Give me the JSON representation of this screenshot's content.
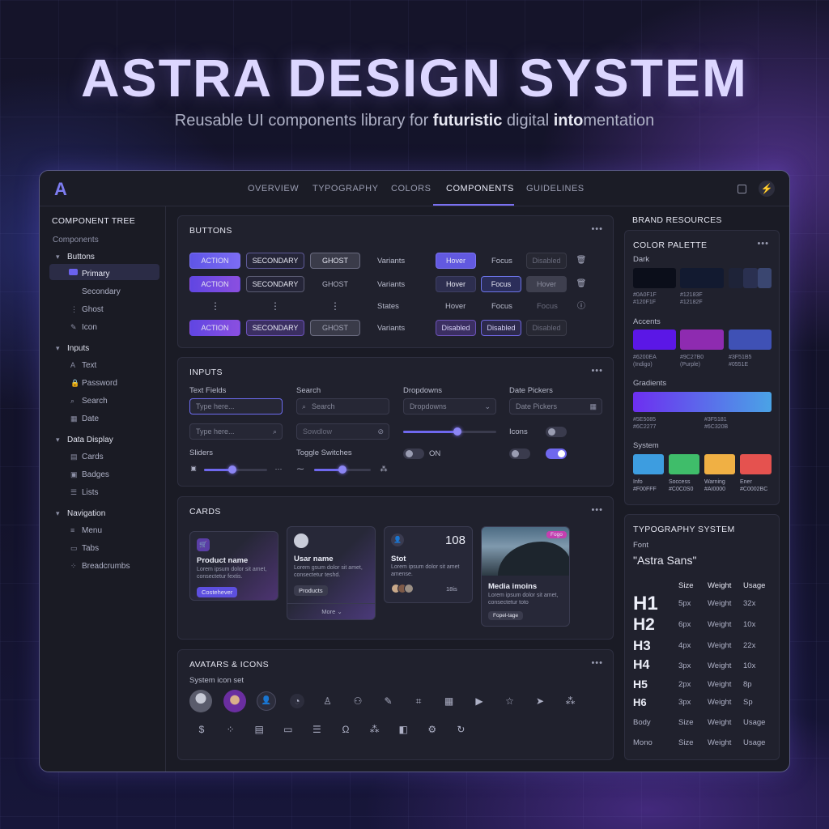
{
  "hero": {
    "title": "ASTRA DESIGN SYSTEM",
    "subtitle_pre": "Reusable UI components library for ",
    "subtitle_bold1": "futuristic",
    "subtitle_mid": " digital ",
    "subtitle_bold2": "into",
    "subtitle_post": "mentation"
  },
  "topbar": {
    "logo": "A",
    "tabs": [
      "OVERVIEW",
      "TYPOGRAPHY",
      "COLORS",
      "COMPONENTS",
      "GUIDELINES"
    ],
    "active_tab": "COMPONENTS"
  },
  "sidebar": {
    "title": "COMPONENT TREE",
    "root": "Components",
    "groups": [
      {
        "label": "Buttons",
        "items": [
          "Primary",
          "Secondary",
          "Ghost",
          "Icon"
        ]
      },
      {
        "label": "Inputs",
        "items": [
          "Text",
          "Password",
          "Search",
          "Date"
        ]
      },
      {
        "label": "Data Display",
        "items": [
          "Cards",
          "Badges",
          "Lists"
        ]
      },
      {
        "label": "Navigation",
        "items": [
          "Menu",
          "Tabs",
          "Breadcrumbs"
        ]
      }
    ]
  },
  "buttons": {
    "title": "BUTTONS",
    "action": "ACTION",
    "secondary": "SECONDARY",
    "ghost": "GHOST",
    "variants": "Variants",
    "states": "States",
    "hover": "Hover",
    "focus": "Focus",
    "disabled": "Disabled"
  },
  "inputs": {
    "title": "INPUTS",
    "text_fields": "Text Fields",
    "search": "Search",
    "dropdowns": "Dropdowns",
    "date_pickers": "Date Pickers",
    "type_here": "Type here...",
    "search_ph": "Search",
    "search_ph2": "Sowdlow",
    "dropdowns_ph": "Dropdowns",
    "date_ph": "Date Pickers",
    "sliders": "Sliders",
    "toggle_switches": "Toggle Switches",
    "icons": "Icons",
    "on": "ON",
    "slider1": 0.58,
    "slider2": 0.45,
    "slider3": 0.5,
    "slider4": 0.62
  },
  "cards": {
    "title": "CARDS",
    "product": {
      "title": "Product name",
      "desc": "Lorem ipsum dolor sit amet, consectetur fextis.",
      "chip": "Costehever"
    },
    "user": {
      "title": "Usar name",
      "desc": "Lorem gsum dolor sit amet, consectetur teshd.",
      "chip": "Products",
      "more": "More"
    },
    "stat": {
      "title": "Stot",
      "value": "108",
      "desc": "Lorem ipsum dolor sit amet amense.",
      "count": "18is"
    },
    "media": {
      "badge": "Fogo",
      "title": "Media imoins",
      "desc": "Lorem ipsum dolor sit amet, consectetur toto",
      "chip": "Fopel-tage"
    }
  },
  "avatars": {
    "title": "AVATARS & ICONS",
    "subtitle": "System icon set",
    "icons_row1": [
      "dashboard-icon",
      "user-icon",
      "users-icon",
      "edit-icon",
      "code-icon",
      "calendar-icon",
      "play-icon",
      "star-icon",
      "send-icon",
      "grid-icon"
    ],
    "icons_row2": [
      "dollar-icon",
      "apps-icon",
      "table-icon",
      "monitor-icon",
      "list-icon",
      "text-icon",
      "grid-icon",
      "sidebar-icon",
      "settings-icon",
      "refresh-icon"
    ]
  },
  "resources": {
    "title": "BRAND RESOURCES",
    "palette_title": "COLOR PALETTE",
    "dark_label": "Dark",
    "accents_label": "Accents",
    "gradients_label": "Gradients",
    "system_label": "System",
    "dark": [
      {
        "color": "#0b0e1a",
        "hex": "#0A0F1F",
        "sub": "#120F1F"
      },
      {
        "color": "#121a30",
        "hex": "#12183F",
        "sub": "#12182F"
      }
    ],
    "dark3": [
      "#1e2338",
      "#2a3050",
      "#3a4670"
    ],
    "accents": [
      {
        "color": "#5b17e6",
        "hex": "#6200EA",
        "sub": "(Indigo)"
      },
      {
        "color": "#8e2bb0",
        "hex": "#9C27B0",
        "sub": "(Purple)"
      },
      {
        "color": "#3f51b5",
        "hex": "#3F51B5",
        "sub": "#0551E"
      }
    ],
    "gradient": {
      "from": "#6d2ff0",
      "to": "#4aa3e6",
      "hex1": "#5E5085",
      "sub1": "#6C2277",
      "hex2": "#3F5181",
      "sub2": "#6C320B"
    },
    "system": [
      {
        "color": "#3d9de0",
        "name": "Info",
        "hex": "#F00FFF"
      },
      {
        "color": "#3fbd6a",
        "name": "Soccess",
        "hex": "#C0C0S0"
      },
      {
        "color": "#f0b044",
        "name": "Warning",
        "hex": "#AI0000"
      },
      {
        "color": "#e5524f",
        "name": "Ener",
        "hex": "#C0002BC"
      }
    ]
  },
  "typography": {
    "title": "TYPOGRAPHY SYSTEM",
    "font_label": "Font",
    "font_name": "\"Astra Sans\"",
    "headers": {
      "size": "Size",
      "weight": "Weight",
      "usage": "Usage"
    },
    "rows": [
      {
        "name": "H1",
        "size": "5px",
        "weight": "Weight",
        "usage": "32x"
      },
      {
        "name": "H2",
        "size": "6px",
        "weight": "Weight",
        "usage": "10x"
      },
      {
        "name": "H3",
        "size": "4px",
        "weight": "Weight",
        "usage": "22x"
      },
      {
        "name": "H4",
        "size": "3px",
        "weight": "Weight",
        "usage": "10x"
      },
      {
        "name": "H5",
        "size": "2px",
        "weight": "Weight",
        "usage": "8p"
      },
      {
        "name": "H6",
        "size": "3px",
        "weight": "Weight",
        "usage": "Sp"
      },
      {
        "name": "Body",
        "size": "Size",
        "weight": "Weight",
        "usage": "Usage"
      },
      {
        "name": "Mono",
        "size": "Size",
        "weight": "Weight",
        "usage": "Usage"
      }
    ]
  }
}
